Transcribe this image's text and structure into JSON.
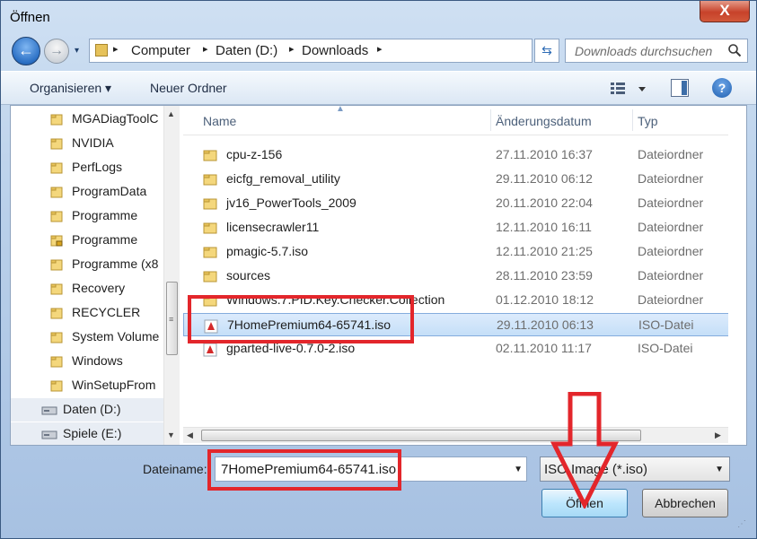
{
  "window": {
    "title": "Öffnen",
    "close": "X"
  },
  "nav": {
    "back": "←",
    "forward": "→",
    "dropdown": "▾",
    "breadcrumbs": [
      "Computer",
      "Daten (D:)",
      "Downloads"
    ],
    "separator": "▸",
    "refresh": "⇆",
    "search_placeholder": "Downloads durchsuchen"
  },
  "toolbar": {
    "organize": "Organisieren ▾",
    "new_folder": "Neuer Ordner",
    "help": "?"
  },
  "sidebar": {
    "items": [
      {
        "label": "MGADiagToolC",
        "icon": "folder-icon"
      },
      {
        "label": "NVIDIA",
        "icon": "folder-icon"
      },
      {
        "label": "PerfLogs",
        "icon": "folder-icon"
      },
      {
        "label": "ProgramData",
        "icon": "folder-icon"
      },
      {
        "label": "Programme",
        "icon": "folder-icon"
      },
      {
        "label": "Programme",
        "icon": "locked-folder-icon"
      },
      {
        "label": "Programme (x8",
        "icon": "folder-icon"
      },
      {
        "label": "Recovery",
        "icon": "folder-icon"
      },
      {
        "label": "RECYCLER",
        "icon": "folder-icon"
      },
      {
        "label": "System Volume",
        "icon": "folder-icon"
      },
      {
        "label": "Windows",
        "icon": "folder-icon"
      },
      {
        "label": "WinSetupFrom",
        "icon": "folder-icon"
      },
      {
        "label": "Daten (D:)",
        "icon": "drive-icon"
      },
      {
        "label": "Spiele (E:)",
        "icon": "drive-icon"
      }
    ]
  },
  "columns": {
    "name": "Name",
    "date": "Änderungsdatum",
    "type": "Typ"
  },
  "files": [
    {
      "name": "cpu-z-156",
      "date": "27.11.2010 16:37",
      "type": "Dateiordner",
      "icon": "folder-icon"
    },
    {
      "name": "eicfg_removal_utility",
      "date": "29.11.2010 06:12",
      "type": "Dateiordner",
      "icon": "folder-icon"
    },
    {
      "name": "jv16_PowerTools_2009",
      "date": "20.11.2010 22:04",
      "type": "Dateiordner",
      "icon": "folder-icon"
    },
    {
      "name": "licensecrawler11",
      "date": "12.11.2010 16:11",
      "type": "Dateiordner",
      "icon": "folder-icon"
    },
    {
      "name": "pmagic-5.7.iso",
      "date": "12.11.2010 21:25",
      "type": "Dateiordner",
      "icon": "folder-icon"
    },
    {
      "name": "sources",
      "date": "28.11.2010 23:59",
      "type": "Dateiordner",
      "icon": "folder-icon"
    },
    {
      "name": "Windows.7.PID.Key.Checker.Collection",
      "date": "01.12.2010 18:12",
      "type": "Dateiordner",
      "icon": "folder-icon"
    },
    {
      "name": "7HomePremium64-65741.iso",
      "date": "29.11.2010 06:13",
      "type": "ISO-Datei",
      "icon": "iso-file-icon",
      "selected": true
    },
    {
      "name": "gparted-live-0.7.0-2.iso",
      "date": "02.11.2010 11:17",
      "type": "ISO-Datei",
      "icon": "iso-file-icon"
    }
  ],
  "footer": {
    "filename_label": "Dateiname:",
    "filename_value": "7HomePremium64-65741.iso",
    "filter_value": "ISO Image (*.iso)",
    "open": "Öffnen",
    "cancel": "Abbrechen"
  },
  "annotations": {
    "color": "#e3262b"
  }
}
